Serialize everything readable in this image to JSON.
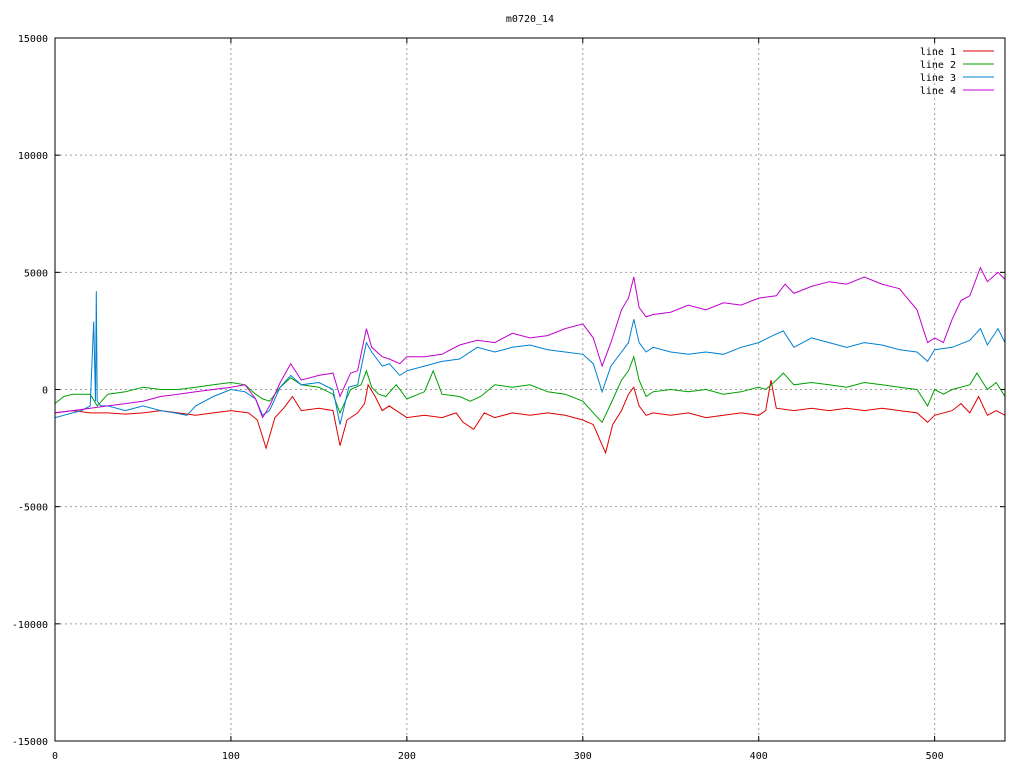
{
  "chart_data": {
    "type": "line",
    "title": "m0720_14",
    "xlabel": "",
    "ylabel": "",
    "xlim": [
      0,
      540
    ],
    "ylim": [
      -15000,
      15000
    ],
    "x_ticks": [
      0,
      100,
      200,
      300,
      400,
      500
    ],
    "y_ticks": [
      -15000,
      -10000,
      -5000,
      0,
      5000,
      10000,
      15000
    ],
    "grid": true,
    "legend_position": "top-right",
    "series": [
      {
        "name": "line 1",
        "color": "#e00000",
        "points": [
          [
            0,
            -1000
          ],
          [
            10,
            -900
          ],
          [
            20,
            -1000
          ],
          [
            30,
            -1000
          ],
          [
            40,
            -1050
          ],
          [
            50,
            -1000
          ],
          [
            60,
            -900
          ],
          [
            70,
            -1000
          ],
          [
            80,
            -1100
          ],
          [
            90,
            -1000
          ],
          [
            100,
            -900
          ],
          [
            110,
            -1000
          ],
          [
            115,
            -1300
          ],
          [
            120,
            -2500
          ],
          [
            125,
            -1200
          ],
          [
            130,
            -800
          ],
          [
            135,
            -300
          ],
          [
            140,
            -900
          ],
          [
            150,
            -800
          ],
          [
            158,
            -900
          ],
          [
            162,
            -2400
          ],
          [
            166,
            -1300
          ],
          [
            172,
            -1000
          ],
          [
            176,
            -600
          ],
          [
            178,
            200
          ],
          [
            182,
            -300
          ],
          [
            186,
            -900
          ],
          [
            190,
            -700
          ],
          [
            196,
            -1000
          ],
          [
            200,
            -1200
          ],
          [
            210,
            -1100
          ],
          [
            220,
            -1200
          ],
          [
            228,
            -1000
          ],
          [
            232,
            -1400
          ],
          [
            238,
            -1700
          ],
          [
            244,
            -1000
          ],
          [
            250,
            -1200
          ],
          [
            260,
            -1000
          ],
          [
            270,
            -1100
          ],
          [
            280,
            -1000
          ],
          [
            290,
            -1100
          ],
          [
            300,
            -1300
          ],
          [
            306,
            -1500
          ],
          [
            310,
            -2200
          ],
          [
            313,
            -2700
          ],
          [
            317,
            -1500
          ],
          [
            322,
            -900
          ],
          [
            326,
            -200
          ],
          [
            329,
            100
          ],
          [
            332,
            -700
          ],
          [
            336,
            -1100
          ],
          [
            340,
            -1000
          ],
          [
            350,
            -1100
          ],
          [
            360,
            -1000
          ],
          [
            370,
            -1200
          ],
          [
            380,
            -1100
          ],
          [
            390,
            -1000
          ],
          [
            400,
            -1100
          ],
          [
            404,
            -900
          ],
          [
            407,
            400
          ],
          [
            410,
            -800
          ],
          [
            420,
            -900
          ],
          [
            430,
            -800
          ],
          [
            440,
            -900
          ],
          [
            450,
            -800
          ],
          [
            460,
            -900
          ],
          [
            470,
            -800
          ],
          [
            480,
            -900
          ],
          [
            490,
            -1000
          ],
          [
            496,
            -1400
          ],
          [
            500,
            -1100
          ],
          [
            510,
            -900
          ],
          [
            515,
            -600
          ],
          [
            520,
            -1000
          ],
          [
            525,
            -300
          ],
          [
            530,
            -1100
          ],
          [
            535,
            -900
          ],
          [
            540,
            -1100
          ]
        ]
      },
      {
        "name": "line 2",
        "color": "#00a000",
        "points": [
          [
            0,
            -600
          ],
          [
            5,
            -300
          ],
          [
            10,
            -200
          ],
          [
            20,
            -200
          ],
          [
            24,
            -700
          ],
          [
            30,
            -200
          ],
          [
            40,
            -100
          ],
          [
            50,
            100
          ],
          [
            60,
            0
          ],
          [
            70,
            0
          ],
          [
            80,
            100
          ],
          [
            90,
            200
          ],
          [
            100,
            300
          ],
          [
            108,
            200
          ],
          [
            114,
            -200
          ],
          [
            118,
            -400
          ],
          [
            122,
            -500
          ],
          [
            128,
            100
          ],
          [
            134,
            500
          ],
          [
            140,
            200
          ],
          [
            150,
            100
          ],
          [
            158,
            -200
          ],
          [
            162,
            -1000
          ],
          [
            168,
            0
          ],
          [
            174,
            200
          ],
          [
            177,
            800
          ],
          [
            180,
            100
          ],
          [
            184,
            -200
          ],
          [
            188,
            -300
          ],
          [
            194,
            200
          ],
          [
            200,
            -400
          ],
          [
            210,
            -100
          ],
          [
            215,
            800
          ],
          [
            220,
            -200
          ],
          [
            230,
            -300
          ],
          [
            236,
            -500
          ],
          [
            242,
            -300
          ],
          [
            250,
            200
          ],
          [
            260,
            100
          ],
          [
            270,
            200
          ],
          [
            280,
            -100
          ],
          [
            290,
            -200
          ],
          [
            300,
            -500
          ],
          [
            306,
            -1000
          ],
          [
            311,
            -1400
          ],
          [
            316,
            -600
          ],
          [
            322,
            400
          ],
          [
            326,
            800
          ],
          [
            329,
            1400
          ],
          [
            332,
            400
          ],
          [
            336,
            -300
          ],
          [
            340,
            -100
          ],
          [
            350,
            0
          ],
          [
            360,
            -100
          ],
          [
            370,
            0
          ],
          [
            380,
            -200
          ],
          [
            390,
            -100
          ],
          [
            400,
            100
          ],
          [
            404,
            0
          ],
          [
            410,
            400
          ],
          [
            414,
            700
          ],
          [
            420,
            200
          ],
          [
            430,
            300
          ],
          [
            440,
            200
          ],
          [
            450,
            100
          ],
          [
            460,
            300
          ],
          [
            470,
            200
          ],
          [
            480,
            100
          ],
          [
            490,
            0
          ],
          [
            496,
            -700
          ],
          [
            500,
            0
          ],
          [
            505,
            -200
          ],
          [
            510,
            0
          ],
          [
            520,
            200
          ],
          [
            524,
            700
          ],
          [
            530,
            0
          ],
          [
            535,
            300
          ],
          [
            540,
            -300
          ]
        ]
      },
      {
        "name": "line 3",
        "color": "#0080d0",
        "points": [
          [
            0,
            -1200
          ],
          [
            5,
            -1100
          ],
          [
            10,
            -1000
          ],
          [
            15,
            -900
          ],
          [
            20,
            -700
          ],
          [
            22,
            2900
          ],
          [
            23,
            -500
          ],
          [
            23.5,
            4200
          ],
          [
            24,
            -500
          ],
          [
            26,
            -700
          ],
          [
            30,
            -700
          ],
          [
            40,
            -900
          ],
          [
            50,
            -700
          ],
          [
            60,
            -900
          ],
          [
            68,
            -1000
          ],
          [
            75,
            -1100
          ],
          [
            80,
            -700
          ],
          [
            90,
            -300
          ],
          [
            100,
            0
          ],
          [
            108,
            -100
          ],
          [
            114,
            -400
          ],
          [
            118,
            -1100
          ],
          [
            122,
            -900
          ],
          [
            128,
            100
          ],
          [
            134,
            600
          ],
          [
            140,
            200
          ],
          [
            150,
            300
          ],
          [
            158,
            0
          ],
          [
            162,
            -1500
          ],
          [
            167,
            100
          ],
          [
            172,
            200
          ],
          [
            177,
            2000
          ],
          [
            180,
            1600
          ],
          [
            186,
            1000
          ],
          [
            190,
            1100
          ],
          [
            196,
            600
          ],
          [
            200,
            800
          ],
          [
            210,
            1000
          ],
          [
            220,
            1200
          ],
          [
            230,
            1300
          ],
          [
            240,
            1800
          ],
          [
            250,
            1600
          ],
          [
            260,
            1800
          ],
          [
            270,
            1900
          ],
          [
            280,
            1700
          ],
          [
            290,
            1600
          ],
          [
            300,
            1500
          ],
          [
            306,
            1100
          ],
          [
            311,
            -100
          ],
          [
            316,
            1000
          ],
          [
            322,
            1600
          ],
          [
            326,
            2000
          ],
          [
            329,
            3000
          ],
          [
            332,
            2000
          ],
          [
            336,
            1600
          ],
          [
            340,
            1800
          ],
          [
            350,
            1600
          ],
          [
            360,
            1500
          ],
          [
            370,
            1600
          ],
          [
            380,
            1500
          ],
          [
            390,
            1800
          ],
          [
            400,
            2000
          ],
          [
            408,
            2300
          ],
          [
            414,
            2500
          ],
          [
            420,
            1800
          ],
          [
            430,
            2200
          ],
          [
            440,
            2000
          ],
          [
            450,
            1800
          ],
          [
            460,
            2000
          ],
          [
            470,
            1900
          ],
          [
            480,
            1700
          ],
          [
            490,
            1600
          ],
          [
            496,
            1200
          ],
          [
            500,
            1700
          ],
          [
            510,
            1800
          ],
          [
            520,
            2100
          ],
          [
            526,
            2600
          ],
          [
            530,
            1900
          ],
          [
            536,
            2600
          ],
          [
            540,
            2000
          ]
        ]
      },
      {
        "name": "line 4",
        "color": "#c000d0",
        "points": [
          [
            0,
            -1000
          ],
          [
            10,
            -900
          ],
          [
            20,
            -800
          ],
          [
            30,
            -700
          ],
          [
            40,
            -600
          ],
          [
            50,
            -500
          ],
          [
            60,
            -300
          ],
          [
            70,
            -200
          ],
          [
            80,
            -100
          ],
          [
            90,
            0
          ],
          [
            100,
            100
          ],
          [
            108,
            200
          ],
          [
            114,
            -400
          ],
          [
            118,
            -1200
          ],
          [
            122,
            -700
          ],
          [
            128,
            300
          ],
          [
            134,
            1100
          ],
          [
            140,
            400
          ],
          [
            150,
            600
          ],
          [
            158,
            700
          ],
          [
            162,
            -300
          ],
          [
            168,
            700
          ],
          [
            172,
            800
          ],
          [
            177,
            2600
          ],
          [
            180,
            1800
          ],
          [
            186,
            1400
          ],
          [
            190,
            1300
          ],
          [
            196,
            1100
          ],
          [
            200,
            1400
          ],
          [
            210,
            1400
          ],
          [
            220,
            1500
          ],
          [
            230,
            1900
          ],
          [
            240,
            2100
          ],
          [
            250,
            2000
          ],
          [
            260,
            2400
          ],
          [
            270,
            2200
          ],
          [
            280,
            2300
          ],
          [
            290,
            2600
          ],
          [
            300,
            2800
          ],
          [
            306,
            2200
          ],
          [
            311,
            1000
          ],
          [
            316,
            2000
          ],
          [
            322,
            3400
          ],
          [
            326,
            3900
          ],
          [
            329,
            4800
          ],
          [
            332,
            3500
          ],
          [
            336,
            3100
          ],
          [
            340,
            3200
          ],
          [
            350,
            3300
          ],
          [
            360,
            3600
          ],
          [
            370,
            3400
          ],
          [
            380,
            3700
          ],
          [
            390,
            3600
          ],
          [
            400,
            3900
          ],
          [
            410,
            4000
          ],
          [
            415,
            4500
          ],
          [
            420,
            4100
          ],
          [
            430,
            4400
          ],
          [
            440,
            4600
          ],
          [
            450,
            4500
          ],
          [
            460,
            4800
          ],
          [
            470,
            4500
          ],
          [
            480,
            4300
          ],
          [
            490,
            3400
          ],
          [
            496,
            2000
          ],
          [
            500,
            2200
          ],
          [
            505,
            2000
          ],
          [
            510,
            3000
          ],
          [
            515,
            3800
          ],
          [
            520,
            4000
          ],
          [
            526,
            5200
          ],
          [
            530,
            4600
          ],
          [
            536,
            5000
          ],
          [
            540,
            4700
          ]
        ]
      }
    ]
  }
}
